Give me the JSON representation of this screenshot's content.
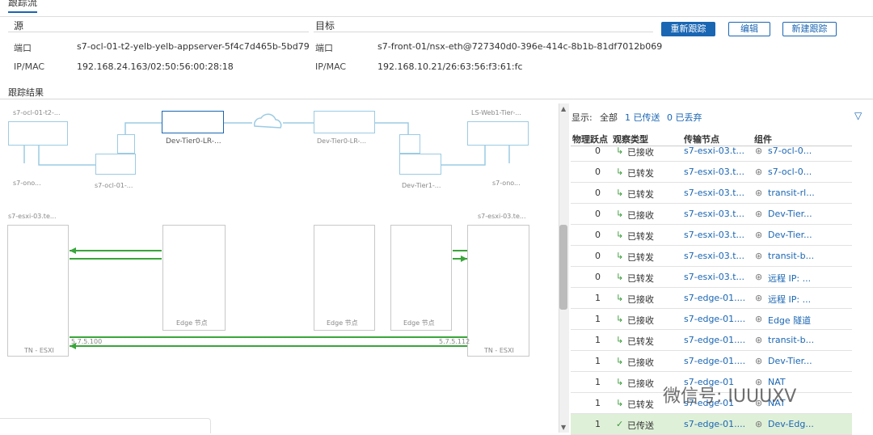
{
  "tab": "跟踪流",
  "source": {
    "title": "源",
    "port_label": "端口",
    "port_value": "s7-ocl-01-t2-yelb-yelb-appserver-5f4c7d465b-5bd79",
    "ipmac_label": "IP/MAC",
    "ipmac_value": "192.168.24.163/02:50:56:00:28:18"
  },
  "target": {
    "title": "目标",
    "port_label": "端口",
    "port_value": "s7-front-01/nsx-eth@727340d0-396e-414c-8b1b-81df7012b069",
    "ipmac_label": "IP/MAC",
    "ipmac_value": "192.168.10.21/26:63:56:f3:61:fc"
  },
  "buttons": {
    "retrace": "重新跟踪",
    "edit": "编辑",
    "new": "新建跟踪"
  },
  "results_title": "跟踪结果",
  "topology": {
    "n1": "s7-ocl-01-t2-...",
    "n2": "s7-ono...",
    "n3": "s7-ocl-01-...",
    "n4": "Dev-Tier0-LR-...",
    "n5": "Dev-Tier0-LR-...",
    "n6": "LS-Web1-Tier-...",
    "n7": "Dev-Tier1-...",
    "n8": "s7-ono...",
    "host_left": "s7-esxi-03.te...",
    "host_right": "s7-esxi-03.te...",
    "tn_left": "TN - ESXI",
    "tn_right": "TN - ESXI",
    "edge1": "Edge 节点",
    "edge2": "Edge 节点",
    "edge3": "Edge 节点",
    "ip_left": "5.7.5.100",
    "ip_right": "5.7.5.112"
  },
  "filter": {
    "label": "显示:",
    "all": "全部",
    "delivered": "1 已传送",
    "dropped": "0 已丢弃"
  },
  "columns": {
    "hops": "物理跃点",
    "type": "观察类型",
    "node": "传输节点",
    "component": "组件"
  },
  "rows": [
    {
      "hops": "0",
      "type": "已接收",
      "node": "s7-esxi-03.t...",
      "comp": "s7-ocl-0..."
    },
    {
      "hops": "0",
      "type": "已转发",
      "node": "s7-esxi-03.t...",
      "comp": "s7-ocl-0..."
    },
    {
      "hops": "0",
      "type": "已转发",
      "node": "s7-esxi-03.t...",
      "comp": "transit-rl..."
    },
    {
      "hops": "0",
      "type": "已接收",
      "node": "s7-esxi-03.t...",
      "comp": "Dev-Tier..."
    },
    {
      "hops": "0",
      "type": "已转发",
      "node": "s7-esxi-03.t...",
      "comp": "Dev-Tier..."
    },
    {
      "hops": "0",
      "type": "已转发",
      "node": "s7-esxi-03.t...",
      "comp": "transit-b..."
    },
    {
      "hops": "0",
      "type": "已转发",
      "node": "s7-esxi-03.t...",
      "comp": "远程 IP: ..."
    },
    {
      "hops": "1",
      "type": "已接收",
      "node": "s7-edge-01....",
      "comp": "远程 IP: ..."
    },
    {
      "hops": "1",
      "type": "已接收",
      "node": "s7-edge-01....",
      "comp": "Edge 隧道"
    },
    {
      "hops": "1",
      "type": "已转发",
      "node": "s7-edge-01....",
      "comp": "transit-b..."
    },
    {
      "hops": "1",
      "type": "已接收",
      "node": "s7-edge-01....",
      "comp": "Dev-Tier..."
    },
    {
      "hops": "1",
      "type": "已接收",
      "node": "s7-edge-01",
      "comp": "NAT"
    },
    {
      "hops": "1",
      "type": "已转发",
      "node": "s7-edge-01",
      "comp": "NAT"
    },
    {
      "hops": "1",
      "type": "已传送",
      "node": "s7-edge-01....",
      "comp": "Dev-Edg..."
    }
  ],
  "watermark": "微信号: IUUUXV"
}
